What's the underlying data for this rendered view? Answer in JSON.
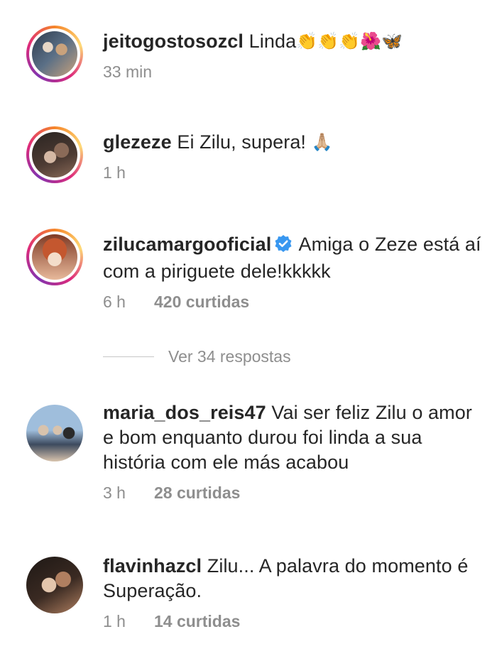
{
  "comments": [
    {
      "username": "jeitogostosozcl",
      "text": "Linda",
      "emojis": "👏👏👏🌺🦋",
      "time": "33 min",
      "likes": "",
      "story_ring": true,
      "avatar_colors": [
        "#2e3b4d",
        "#c9a27c",
        "#e7d7c6",
        "#5a6f86"
      ]
    },
    {
      "username": "glezeze",
      "text": "Ei Zilu, supera!",
      "emojis": "🙏🏼",
      "time": "1 h",
      "likes": "",
      "story_ring": true,
      "avatar_colors": [
        "#2b2522",
        "#8a6a58",
        "#d4b8a4",
        "#4d3b33"
      ]
    },
    {
      "username": "zilucamargooficial",
      "verified": true,
      "text": "Amiga o Zeze está aí com a piriguete dele!kkkkk",
      "time": "6 h",
      "likes": "420 curtidas",
      "story_ring": true,
      "avatar_colors": [
        "#c4572f",
        "#e7b99b",
        "#f3ddca",
        "#7f3a24"
      ]
    },
    {
      "username": "maria_dos_reis47",
      "text": "Vai ser feliz Zilu o amor e bom enquanto durou foi linda a sua história com ele más acabou",
      "time": "3 h",
      "likes": "28 curtidas",
      "story_ring": false,
      "avatar_colors": [
        "#9fbedc",
        "#3d4a5e",
        "#d8c3ad",
        "#2a2a2a"
      ]
    },
    {
      "username": "flavinhazcl",
      "text": "Zilu... A palavra do momento é Superação.",
      "time": "1 h",
      "likes": "14 curtidas",
      "story_ring": false,
      "avatar_colors": [
        "#3a2a22",
        "#b07f60",
        "#e3c6ad",
        "#1e1815"
      ]
    }
  ],
  "view_replies": "Ver 34 respostas",
  "colors": {
    "text": "#262626",
    "meta": "#8e8e8e",
    "verified": "#3897f0"
  }
}
